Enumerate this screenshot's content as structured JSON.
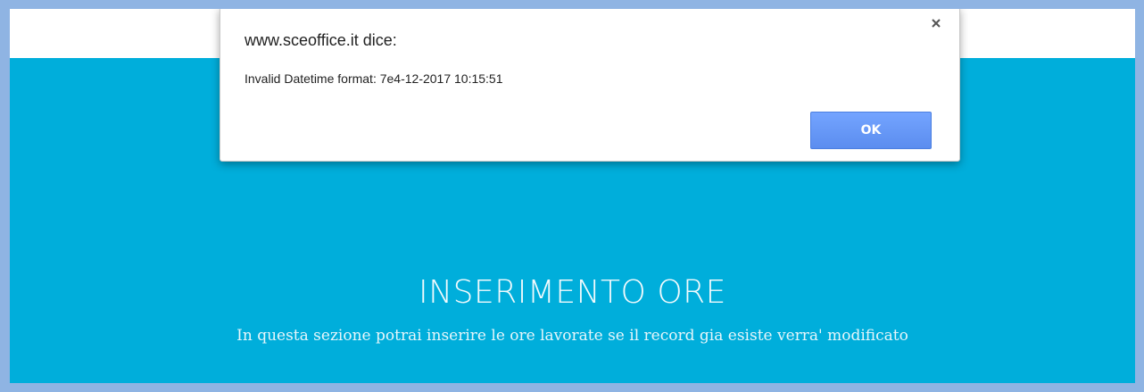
{
  "hero": {
    "title": "INSERIMENTO ORE",
    "subtitle": "In questa sezione potrai inserire le ore lavorate se il record gia esiste verra' modificato"
  },
  "dialog": {
    "title": "www.sceoffice.it dice:",
    "message": "Invalid Datetime format: 7e4-12-2017 10:15:51",
    "ok_label": "OK",
    "close_icon": "close-icon"
  },
  "colors": {
    "frame": "#8fb4e3",
    "hero_background": "#00aedb",
    "ok_button": "#5b8def"
  }
}
